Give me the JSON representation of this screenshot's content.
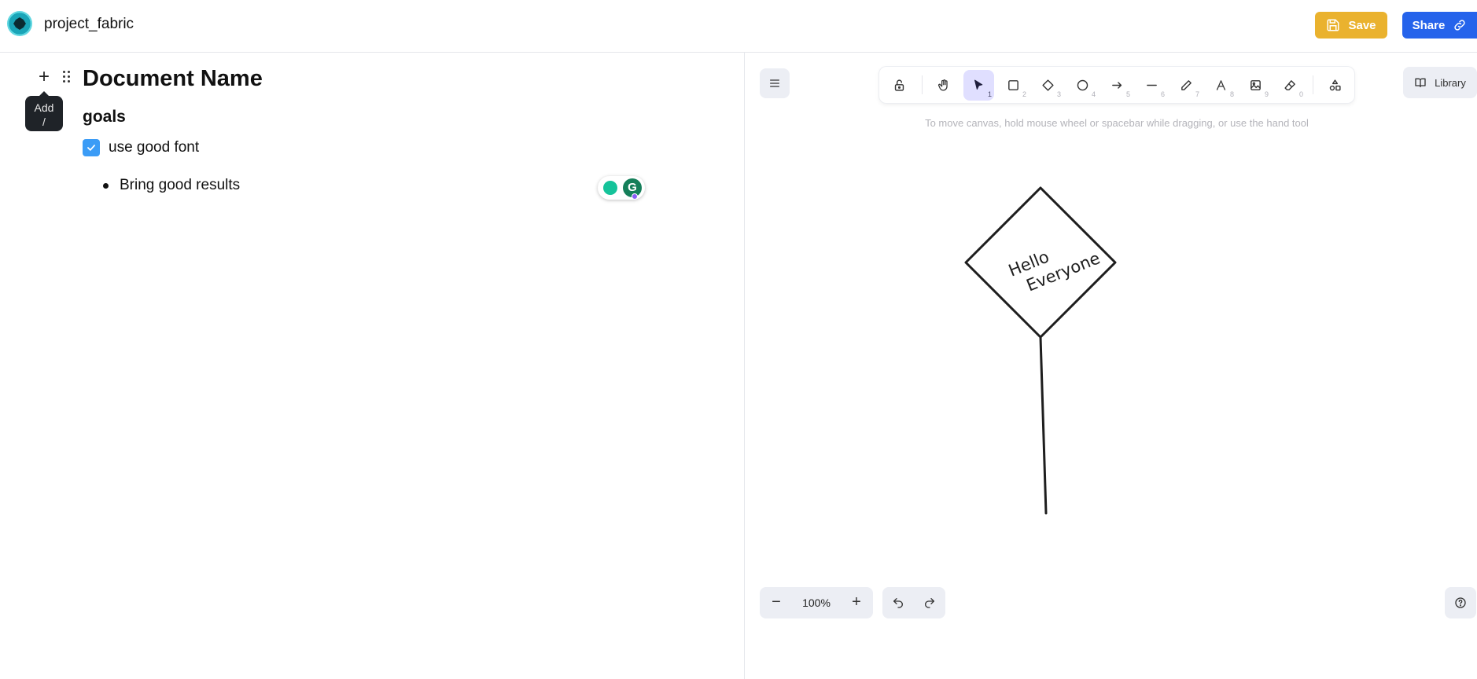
{
  "header": {
    "project_name": "project_fabric",
    "save_label": "Save",
    "share_label": "Share"
  },
  "editor": {
    "add_tooltip_line1": "Add",
    "add_tooltip_line2": "/",
    "document_title": "Document Name",
    "heading": "goals",
    "checklist": [
      {
        "label": "use good font",
        "checked": true
      }
    ],
    "bullets": [
      {
        "label": "Bring good results"
      }
    ],
    "grammarly_letter": "G"
  },
  "canvas": {
    "toolbar": [
      {
        "name": "lock",
        "icon": "lock-icon"
      },
      {
        "name": "hand",
        "icon": "hand-icon"
      },
      {
        "name": "selection",
        "icon": "cursor-icon",
        "shortcut": "1",
        "active": true
      },
      {
        "name": "rectangle",
        "icon": "rectangle-icon",
        "shortcut": "2"
      },
      {
        "name": "diamond",
        "icon": "diamond-icon",
        "shortcut": "3"
      },
      {
        "name": "ellipse",
        "icon": "ellipse-icon",
        "shortcut": "4"
      },
      {
        "name": "arrow",
        "icon": "arrow-icon",
        "shortcut": "5"
      },
      {
        "name": "line",
        "icon": "line-icon",
        "shortcut": "6"
      },
      {
        "name": "draw",
        "icon": "pencil-icon",
        "shortcut": "7"
      },
      {
        "name": "text",
        "icon": "text-icon",
        "shortcut": "8"
      },
      {
        "name": "image",
        "icon": "image-icon",
        "shortcut": "9"
      },
      {
        "name": "eraser",
        "icon": "eraser-icon",
        "shortcut": "0"
      },
      {
        "name": "extra-tools",
        "icon": "shapes-icon"
      }
    ],
    "library_label": "Library",
    "hint": "To move canvas, hold mouse wheel or spacebar while dragging, or use the hand tool",
    "diamond_text_line1": "Hello",
    "diamond_text_line2": "Everyone",
    "zoom_level": "100%",
    "accent_color": "#e0dfff"
  },
  "colors": {
    "save": "#eab22e",
    "share": "#2563eb",
    "checkbox": "#3b9cf6"
  }
}
